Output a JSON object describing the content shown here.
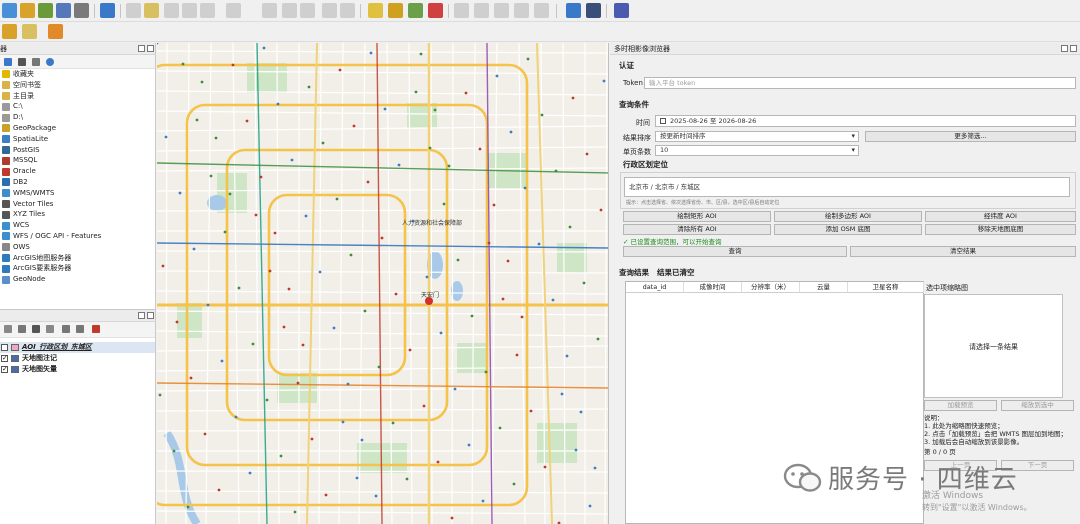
{
  "browser": {
    "title": "器",
    "items": [
      {
        "label": "收藏夹",
        "icon": "star-icon",
        "color": "#e0b800"
      },
      {
        "label": "空间书签",
        "icon": "bookmark-icon",
        "color": "#d9b24a"
      },
      {
        "label": "主目录",
        "icon": "home-folder-icon",
        "color": "#d9b24a"
      },
      {
        "label": "C:\\",
        "icon": "drive-icon",
        "color": "#9a9a9a"
      },
      {
        "label": "D:\\",
        "icon": "drive-icon",
        "color": "#9a9a9a"
      },
      {
        "label": "GeoPackage",
        "icon": "geopackage-icon",
        "color": "#c9a12a"
      },
      {
        "label": "SpatiaLite",
        "icon": "spatialite-icon",
        "color": "#3a7fc4"
      },
      {
        "label": "PostGIS",
        "icon": "postgis-icon",
        "color": "#336699"
      },
      {
        "label": "MSSQL",
        "icon": "mssql-icon",
        "color": "#b03a2e"
      },
      {
        "label": "Oracle",
        "icon": "oracle-icon",
        "color": "#c0392b"
      },
      {
        "label": "DB2",
        "icon": "db2-icon",
        "color": "#2a6fb0"
      },
      {
        "label": "WMS/WMTS",
        "icon": "wms-icon",
        "color": "#3b8ed0"
      },
      {
        "label": "Vector Tiles",
        "icon": "vector-tiles-icon",
        "color": "#555555"
      },
      {
        "label": "XYZ Tiles",
        "icon": "xyz-tiles-icon",
        "color": "#555555"
      },
      {
        "label": "WCS",
        "icon": "wcs-icon",
        "color": "#3b8ed0"
      },
      {
        "label": "WFS / OGC API - Features",
        "icon": "wfs-icon",
        "color": "#3b8ed0"
      },
      {
        "label": "OWS",
        "icon": "ows-icon",
        "color": "#888888"
      },
      {
        "label": "ArcGIS地图服务器",
        "icon": "arcgis-map-icon",
        "color": "#2f7bbf"
      },
      {
        "label": "ArcGIS要素服务器",
        "icon": "arcgis-feature-icon",
        "color": "#2f7bbf"
      },
      {
        "label": "GeoNode",
        "icon": "geonode-icon",
        "color": "#5b8fc9"
      }
    ]
  },
  "layers": {
    "items": [
      {
        "label": "AOI_行政区划_东城区",
        "checked": false,
        "swatch": "#f2a9c0"
      },
      {
        "label": "天地图注记",
        "checked": true,
        "swatch": "#4a6da7"
      },
      {
        "label": "天地图矢量",
        "checked": true,
        "swatch": "#4a6da7"
      }
    ]
  },
  "map": {
    "labels": [
      "人力资源和社会保障部",
      "天安门"
    ]
  },
  "plugin": {
    "title": "多时相影像浏览器",
    "auth_section": "认证",
    "token_label": "Token",
    "token_placeholder": "输入平台 token",
    "query_section": "查询条件",
    "time_label": "时间",
    "date_start": "2025-08-26",
    "date_to": "至",
    "date_end": "2026-08-26",
    "sort_label": "结果排序",
    "sort_value": "按更新时间排序",
    "more_filter": "更多筛选...",
    "page_size_label": "单页条数",
    "page_size_value": "10",
    "region_section": "行政区划定位",
    "region_value": "北京市 / 北京市 / 东城区",
    "region_hint": "提示：点击选择省、依次选择省份、市、区/县，选中区/县后自动定位",
    "btn_rect": "绘制矩形 AOI",
    "btn_polygon": "绘制多边形 AOI",
    "btn_lonlat": "经纬度 AOI",
    "btn_clear_aoi": "清除所有 AOI",
    "btn_osm": "添加 OSM 底图",
    "btn_remove_tianditu": "移除天地图底图",
    "status": "✓ 已设置查询范围，可以开始查询",
    "btn_query": "查询",
    "btn_clear_results": "清空结果",
    "results_section": "查询结果",
    "results_status": "结果已清空",
    "columns": [
      "data_id",
      "成像时间",
      "分辨率（米）",
      "云量",
      "卫星名称"
    ],
    "thumb_title": "选中项缩略图",
    "thumb_placeholder": "请选择一条结果",
    "btn_load_preview": "加载预览",
    "btn_zoom_to": "缩放到选中",
    "notes": [
      "说明：",
      "1. 此处为缩略图快速预览；",
      "2. 点击「加载预览」会把 WMTS 图层加到地图；",
      "3. 加载后会自动缩放到该景影像。"
    ],
    "page_info": "第 0 / 0 页",
    "btn_prev": "上一页",
    "btn_next": "下一页"
  },
  "watermark": {
    "text": "服务号 · 四维云",
    "win1": "激活 Windows",
    "win2": "转到\"设置\"以激活 Windows。"
  }
}
